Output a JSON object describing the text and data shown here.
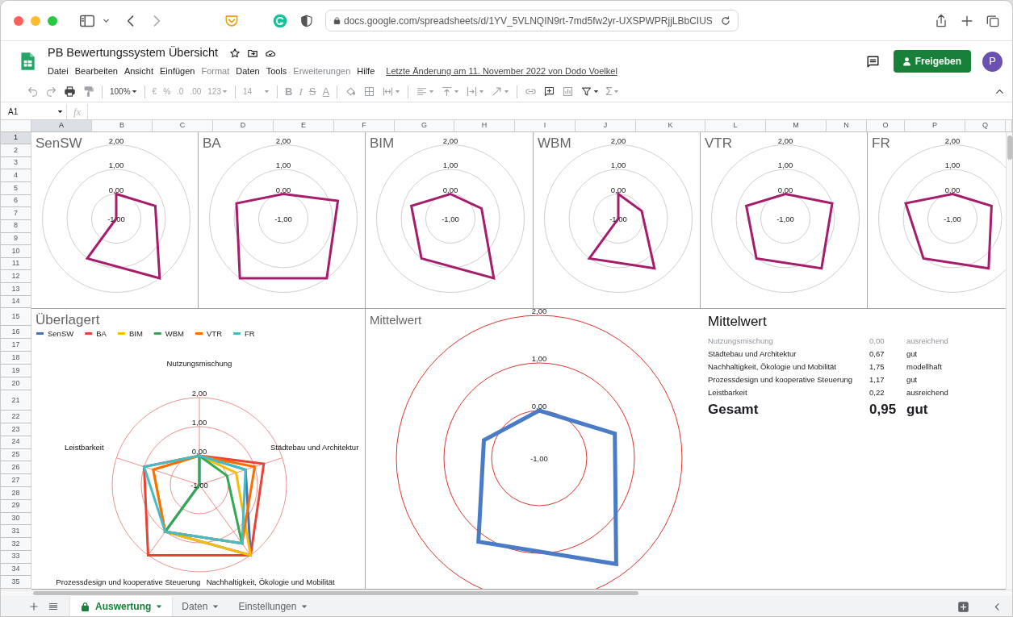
{
  "browser": {
    "url": "docs.google.com/spreadsheets/d/1YV_5VLNQIN9rt-7md5fw2yr-UXSPWPRjjLBbCIUS"
  },
  "document": {
    "title": "PB Bewertungssystem Übersicht",
    "last_edit": "Letzte Änderung am 11. November 2022 von Dodo Voelkel",
    "share_button": "Freigeben",
    "avatar": "P",
    "menu": [
      {
        "label": "Datei",
        "disabled": false
      },
      {
        "label": "Bearbeiten",
        "disabled": false
      },
      {
        "label": "Ansicht",
        "disabled": false
      },
      {
        "label": "Einfügen",
        "disabled": false
      },
      {
        "label": "Format",
        "disabled": true
      },
      {
        "label": "Daten",
        "disabled": false
      },
      {
        "label": "Tools",
        "disabled": false
      },
      {
        "label": "Erweiterungen",
        "disabled": true
      },
      {
        "label": "Hilfe",
        "disabled": false
      }
    ]
  },
  "toolbar": [
    [
      {
        "kind": "undo",
        "disabled": true
      },
      {
        "kind": "redo",
        "disabled": true
      },
      {
        "kind": "print",
        "disabled": false
      },
      {
        "kind": "paint-format",
        "disabled": true
      }
    ],
    [
      {
        "kind": "zoom",
        "text": "100%",
        "disabled": false
      }
    ],
    [
      {
        "kind": "currency",
        "text": "€",
        "disabled": true
      },
      {
        "kind": "percent",
        "text": "%",
        "disabled": true
      },
      {
        "kind": "decimal-less",
        "text": ".0",
        "disabled": true
      },
      {
        "kind": "decimal-more",
        "text": ".00",
        "disabled": true
      },
      {
        "kind": "number-format",
        "text": "123",
        "disabled": true
      }
    ],
    [
      {
        "kind": "font-size",
        "text": "14",
        "disabled": true
      }
    ],
    [
      {
        "kind": "bold",
        "text": "B",
        "disabled": true
      },
      {
        "kind": "italic",
        "text": "I",
        "disabled": true
      },
      {
        "kind": "strikethrough",
        "text": "S",
        "disabled": true
      },
      {
        "kind": "text-color",
        "text": "A",
        "disabled": true
      }
    ],
    [
      {
        "kind": "fill-color",
        "disabled": true
      },
      {
        "kind": "borders",
        "disabled": true
      },
      {
        "kind": "merge",
        "disabled": true
      }
    ],
    [
      {
        "kind": "align",
        "disabled": true
      },
      {
        "kind": "valign",
        "disabled": true
      },
      {
        "kind": "wrap",
        "disabled": true
      },
      {
        "kind": "rotate",
        "disabled": true
      }
    ],
    [
      {
        "kind": "link",
        "disabled": true
      },
      {
        "kind": "comment",
        "disabled": false
      },
      {
        "kind": "chart",
        "disabled": true
      },
      {
        "kind": "filter",
        "disabled": false
      },
      {
        "kind": "functions",
        "text": "Σ",
        "disabled": true
      }
    ]
  ],
  "formula_bar": {
    "cell": "A1",
    "fx": "fx"
  },
  "columns": [
    {
      "label": "A",
      "selected": true
    },
    {
      "label": "B",
      "selected": false
    },
    {
      "label": "C",
      "selected": false
    },
    {
      "label": "D",
      "selected": false
    },
    {
      "label": "E",
      "selected": false
    },
    {
      "label": "F",
      "selected": false
    },
    {
      "label": "G",
      "selected": false
    },
    {
      "label": "H",
      "selected": false
    },
    {
      "label": "I",
      "selected": false
    },
    {
      "label": "J",
      "selected": false
    },
    {
      "label": "K",
      "selected": false
    },
    {
      "label": "L",
      "selected": false
    },
    {
      "label": "M",
      "selected": false
    },
    {
      "label": "N",
      "selected": false
    },
    {
      "label": "O",
      "selected": false
    },
    {
      "label": "P",
      "selected": false
    },
    {
      "label": "Q",
      "selected": false
    }
  ],
  "rows": [
    {
      "label": "1",
      "selected": true
    },
    {
      "label": "2",
      "selected": false
    },
    {
      "label": "3",
      "selected": false
    },
    {
      "label": "4",
      "selected": false
    },
    {
      "label": "5",
      "selected": false
    },
    {
      "label": "6",
      "selected": false
    },
    {
      "label": "7",
      "selected": false
    },
    {
      "label": "8",
      "selected": false
    },
    {
      "label": "9",
      "selected": false
    },
    {
      "label": "10",
      "selected": false
    },
    {
      "label": "11",
      "selected": false
    },
    {
      "label": "12",
      "selected": false
    },
    {
      "label": "13",
      "selected": false
    },
    {
      "label": "14",
      "selected": false
    },
    {
      "label": "15",
      "selected": false
    },
    {
      "label": "16",
      "selected": false
    },
    {
      "label": "17",
      "selected": false
    },
    {
      "label": "18",
      "selected": false
    },
    {
      "label": "19",
      "selected": false
    },
    {
      "label": "20",
      "selected": false
    },
    {
      "label": "21",
      "selected": false
    },
    {
      "label": "22",
      "selected": false
    },
    {
      "label": "23",
      "selected": false
    },
    {
      "label": "24",
      "selected": false
    },
    {
      "label": "25",
      "selected": false
    },
    {
      "label": "26",
      "selected": false
    },
    {
      "label": "27",
      "selected": false
    },
    {
      "label": "28",
      "selected": false
    },
    {
      "label": "29",
      "selected": false
    },
    {
      "label": "30",
      "selected": false
    },
    {
      "label": "31",
      "selected": false
    },
    {
      "label": "32",
      "selected": false
    },
    {
      "label": "33",
      "selected": false
    },
    {
      "label": "34",
      "selected": false
    },
    {
      "label": "35",
      "selected": false
    }
  ],
  "charts": [
    {
      "kind": "small",
      "title": "SenSW",
      "tick_labels": [
        "2,00",
        "1,00",
        "0,00",
        "-1,00"
      ]
    },
    {
      "kind": "small",
      "title": "BA",
      "tick_labels": [
        "2,00",
        "1,00",
        "0,00",
        "-1,00"
      ]
    },
    {
      "kind": "small",
      "title": "BIM",
      "tick_labels": [
        "2,00",
        "1,00",
        "0,00",
        "-1,00"
      ]
    },
    {
      "kind": "small",
      "title": "WBM",
      "tick_labels": [
        "2,00",
        "1,00",
        "0,00",
        "-1,00"
      ]
    },
    {
      "kind": "small",
      "title": "VTR",
      "tick_labels": [
        "2,00",
        "1,00",
        "0,00",
        "-1,00"
      ]
    },
    {
      "kind": "small",
      "title": "FR",
      "tick_labels": [
        "2,00",
        "1,00",
        "0,00",
        "-1,00"
      ]
    },
    {
      "kind": "overlay",
      "title": "Überlagert",
      "legend": [
        {
          "name": "SenSW",
          "color": "#4472c4"
        },
        {
          "name": "BA",
          "color": "#ea4335"
        },
        {
          "name": "BIM",
          "color": "#fbbc04"
        },
        {
          "name": "WBM",
          "color": "#34a853"
        },
        {
          "name": "VTR",
          "color": "#ff6d01"
        },
        {
          "name": "FR",
          "color": "#46bdc6"
        }
      ],
      "axis_labels": [
        "Nutzungsmischung",
        "Leistbarkeit",
        "Städtebau und Architektur",
        "Prozessdesign und kooperative Steuerung",
        "Nachhaltigkeit, Ökologie und Mobilität"
      ],
      "tick_labels": [
        "2,00",
        "1,00",
        "0,00",
        "-1,00"
      ]
    },
    {
      "kind": "average",
      "title": "Mittelwert",
      "tick_labels": [
        "2,00",
        "1,00",
        "0,00",
        "-1,00"
      ]
    }
  ],
  "summary": {
    "title": "Mittelwert",
    "rows": [
      {
        "label": "Nutzungsmischung",
        "value": "0,00",
        "rating": "ausreichend",
        "dimmed": true
      },
      {
        "label": "Städtebau und Architektur",
        "value": "0,67",
        "rating": "gut",
        "dimmed": false
      },
      {
        "label": "Nachhaltigkeit, Ökologie und Mobilität",
        "value": "1,75",
        "rating": "modellhaft",
        "dimmed": false
      },
      {
        "label": "Prozessdesign und kooperative Steuerung",
        "value": "1,17",
        "rating": "gut",
        "dimmed": false
      },
      {
        "label": "Leistbarkeit",
        "value": "0,22",
        "rating": "ausreichend",
        "dimmed": false
      }
    ],
    "total": {
      "label": "Gesamt",
      "value": "0,95",
      "rating": "gut"
    }
  },
  "sheet_tabs": [
    {
      "label": "Auswertung",
      "selected": true,
      "locked": true
    },
    {
      "label": "Daten",
      "selected": false,
      "locked": false
    },
    {
      "label": "Einstellungen",
      "selected": false,
      "locked": false
    }
  ]
}
